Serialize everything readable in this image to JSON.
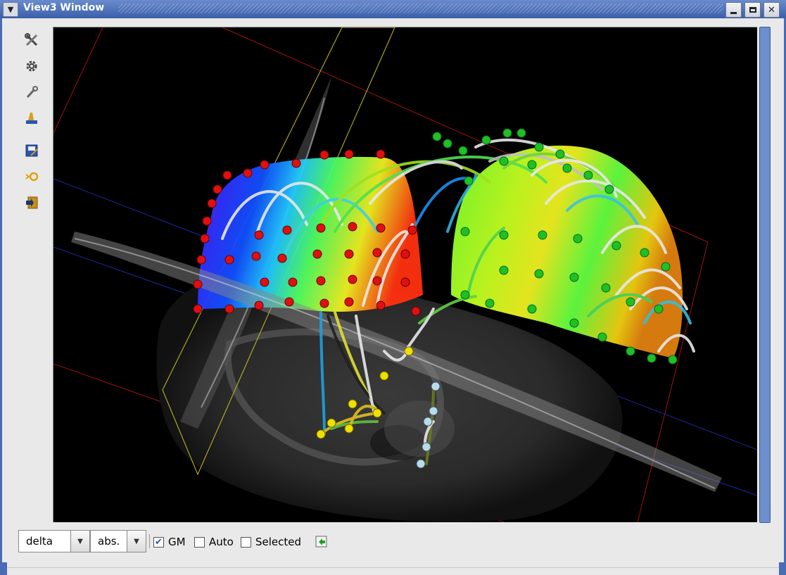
{
  "window": {
    "title": "View3 Window",
    "menu_icon": "chevron-down-icon",
    "buttons": [
      "minimize-icon",
      "maximize-icon",
      "close-icon"
    ]
  },
  "toolbar": {
    "tools": [
      {
        "name": "tools-icon"
      },
      {
        "name": "settings-gear-icon"
      },
      {
        "name": "wrench-icon"
      },
      {
        "name": "paint-brush-icon"
      },
      {
        "name": "save-snapshot-icon"
      },
      {
        "name": "record-icon"
      },
      {
        "name": "export-icon"
      }
    ]
  },
  "controls": {
    "mode_select": {
      "value": "delta"
    },
    "scale_select": {
      "value": "abs."
    },
    "gm": {
      "label": "GM",
      "checked": true
    },
    "auto": {
      "label": "Auto",
      "checked": false
    },
    "selected": {
      "label": "Selected",
      "checked": false
    },
    "apply_icon": "apply-arrow-icon"
  },
  "colors": {
    "titlebar": "#3a5ea9",
    "frame": "#4a6bb5",
    "viewport_bg": "#000000",
    "scrollbar": "#6e8fce",
    "electrode_red": "#e01010",
    "electrode_green": "#20c020",
    "electrode_yellow": "#f0e000",
    "electrode_lightblue": "#b0d8e8"
  }
}
